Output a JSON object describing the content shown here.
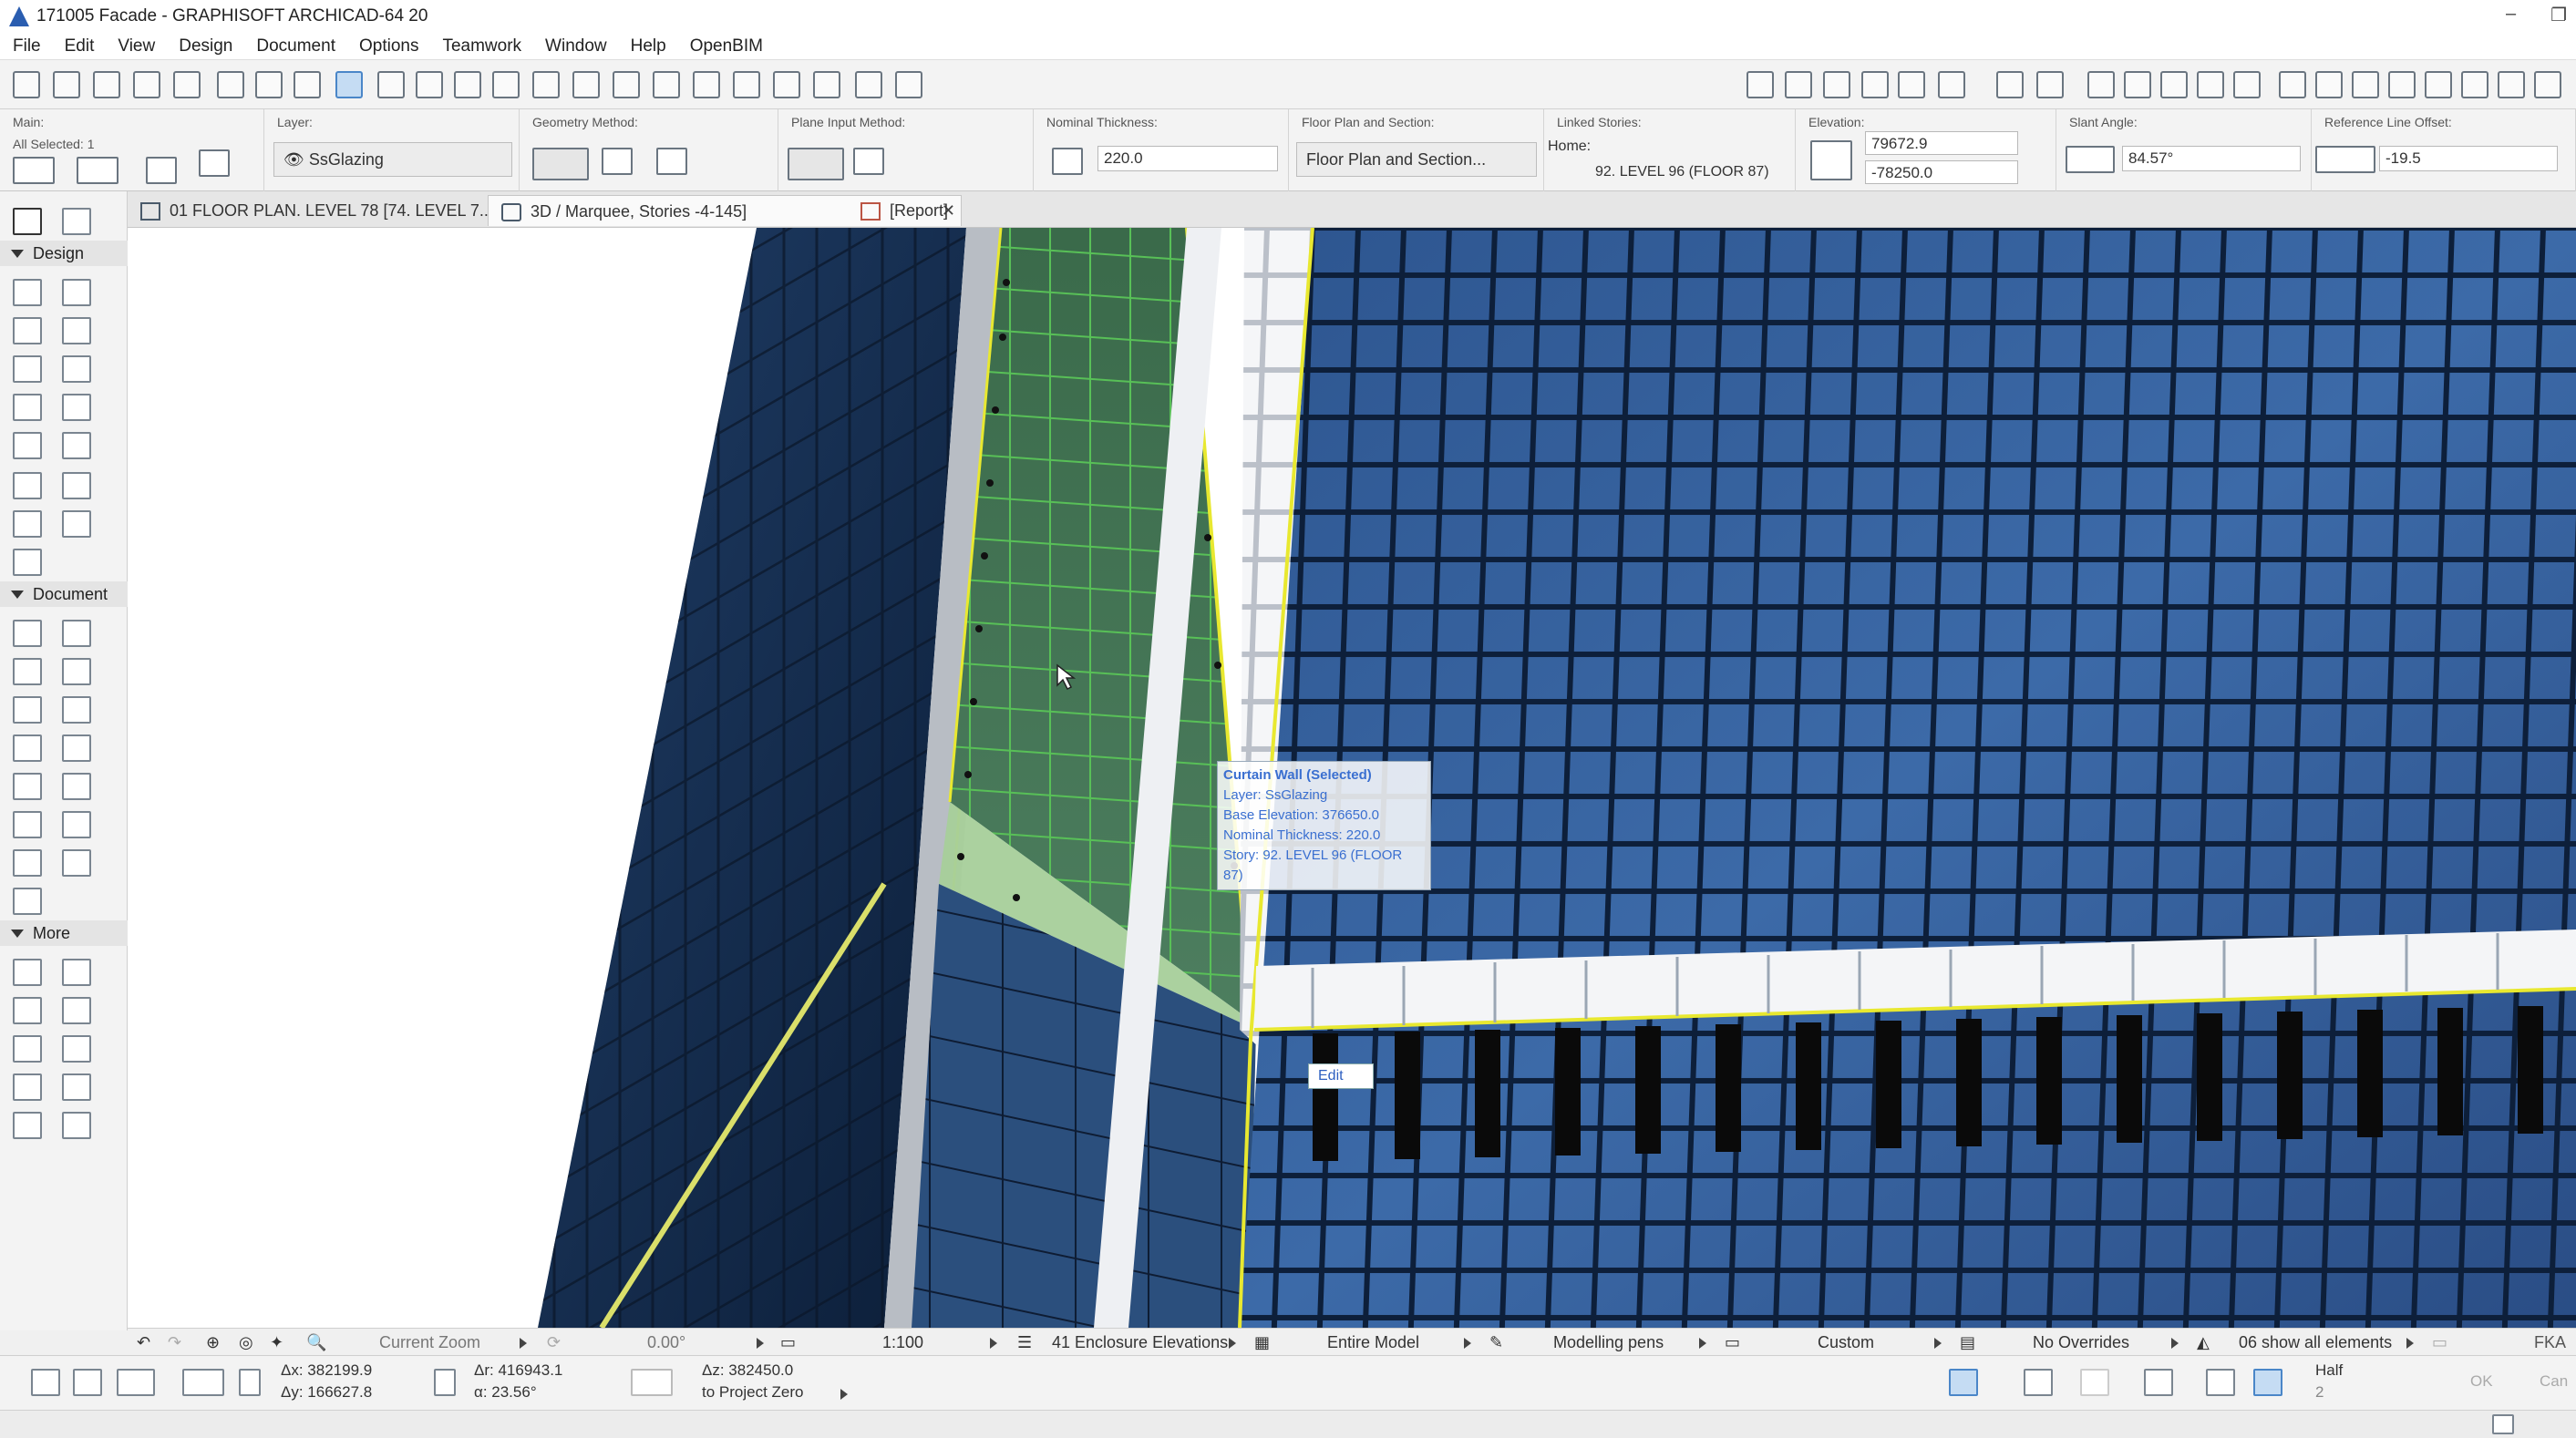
{
  "window": {
    "title": "171005 Facade - GRAPHISOFT ARCHICAD-64 20"
  },
  "menu": [
    "File",
    "Edit",
    "View",
    "Design",
    "Document",
    "Options",
    "Teamwork",
    "Window",
    "Help",
    "OpenBIM"
  ],
  "infobox": {
    "main_label": "Main:",
    "selected": "All Selected: 1",
    "layer_label": "Layer:",
    "layer_value": "SsGlazing",
    "geometry_label": "Geometry Method:",
    "plane_label": "Plane Input Method:",
    "thickness_label": "Nominal Thickness:",
    "thickness_value": "220.0",
    "floorplan_label": "Floor Plan and Section:",
    "floorplan_value": "Floor Plan and Section...",
    "linked_label": "Linked Stories:",
    "home_label": "Home:",
    "home_value": "92. LEVEL 96 (FLOOR 87)",
    "elevation_label": "Elevation:",
    "elevation_top": "79672.9",
    "elevation_bottom": "-78250.0",
    "slant_label": "Slant Angle:",
    "slant_value": "84.57°",
    "refline_label": "Reference Line Offset:",
    "refline_value": "-19.5"
  },
  "toolbox": {
    "sections": [
      "Design",
      "Document",
      "More"
    ]
  },
  "tabs": [
    {
      "label": "01 FLOOR PLAN. LEVEL 78 [74. LEVEL 7..."
    },
    {
      "label": "3D / Marquee, Stories -4-145]"
    },
    {
      "label": "[Report]"
    }
  ],
  "tooltip": {
    "title": "Curtain Wall (Selected)",
    "layer": "Layer: SsGlazing",
    "base": "Base Elevation: 376650.0",
    "thickness": "Nominal Thickness: 220.0",
    "story": "Story: 92. LEVEL 96 (FLOOR 87)"
  },
  "edit_chip": "Edit",
  "statusbar": {
    "zoom": "Current Zoom",
    "angle": "0.00°",
    "scale": "1:100",
    "layer_combo": "41 Enclosure Elevations",
    "model": "Entire Model",
    "pens": "Modelling pens",
    "custom": "Custom",
    "overrides": "No Overrides",
    "renovation": "06 show all elements",
    "fka": "FKA"
  },
  "coords": {
    "dx": "Δx: 382199.9",
    "dy": "Δy: 166627.8",
    "dr": "Δr: 416943.1",
    "angle": "α: 23.56°",
    "dz": "Δz: 382450.0",
    "ref": "to Project Zero",
    "half": "Half",
    "half_num": "2",
    "ok": "OK",
    "cancel": "Can"
  }
}
